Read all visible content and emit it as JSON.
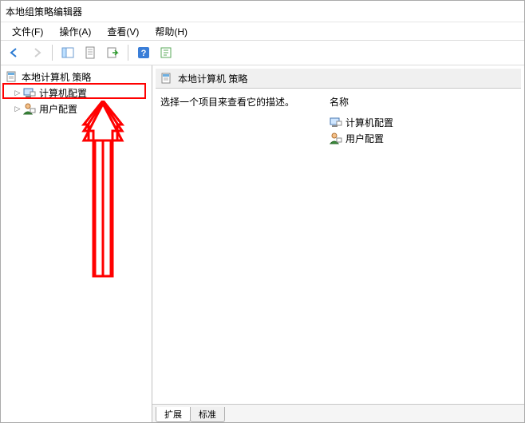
{
  "window": {
    "title": "本地组策略编辑器"
  },
  "menubar": {
    "file": "文件(F)",
    "action": "操作(A)",
    "view": "查看(V)",
    "help": "帮助(H)"
  },
  "tree": {
    "root": "本地计算机 策略",
    "computer_config": "计算机配置",
    "user_config": "用户配置"
  },
  "right": {
    "title": "本地计算机 策略",
    "desc": "选择一个项目来查看它的描述。",
    "name_header": "名称",
    "items": {
      "computer_config": "计算机配置",
      "user_config": "用户配置"
    },
    "tabs": {
      "extended": "扩展",
      "standard": "标准"
    }
  }
}
